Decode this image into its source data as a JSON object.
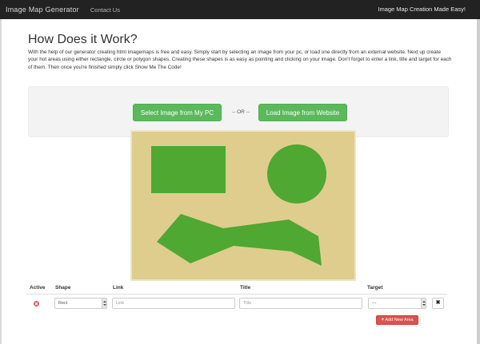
{
  "navbar": {
    "brand": "Image Map Generator",
    "contact": "Contact Us",
    "tagline": "Image Map Creation Made Easy!"
  },
  "main": {
    "title": "How Does it Work?",
    "intro": "With the help of our generator creating html imagemaps is free and easy. Simply start by selecting an image from your pc, or load one directly from an external website. Next up create your hot areas using either rectangle, circle or polygon shapes. Creating these shapes is as easy as pointing and clicking on your image. Don't forget to enter a link, title and target for each of them. Then once you're finished simply click Show Me The Code!"
  },
  "upload": {
    "select_pc_label": "Select Image from My PC",
    "or_text": "-- OR --",
    "load_web_label": "Load Image from Website"
  },
  "canvas": {
    "background_color": "#dfcd8e",
    "shape_color": "#4ea832",
    "shapes": [
      "rectangle",
      "circle",
      "polygon"
    ]
  },
  "areas_table": {
    "headers": {
      "active": "Active",
      "shape": "Shape",
      "link": "Link",
      "title": "Title",
      "target": "Target"
    },
    "rows": [
      {
        "shape": "Rect",
        "link_placeholder": "Link",
        "title_placeholder": "Title",
        "target": "---"
      }
    ],
    "add_label": "Add New Area"
  },
  "colors": {
    "navbar": "#222222",
    "success": "#5cb85c",
    "danger": "#d9534f"
  }
}
